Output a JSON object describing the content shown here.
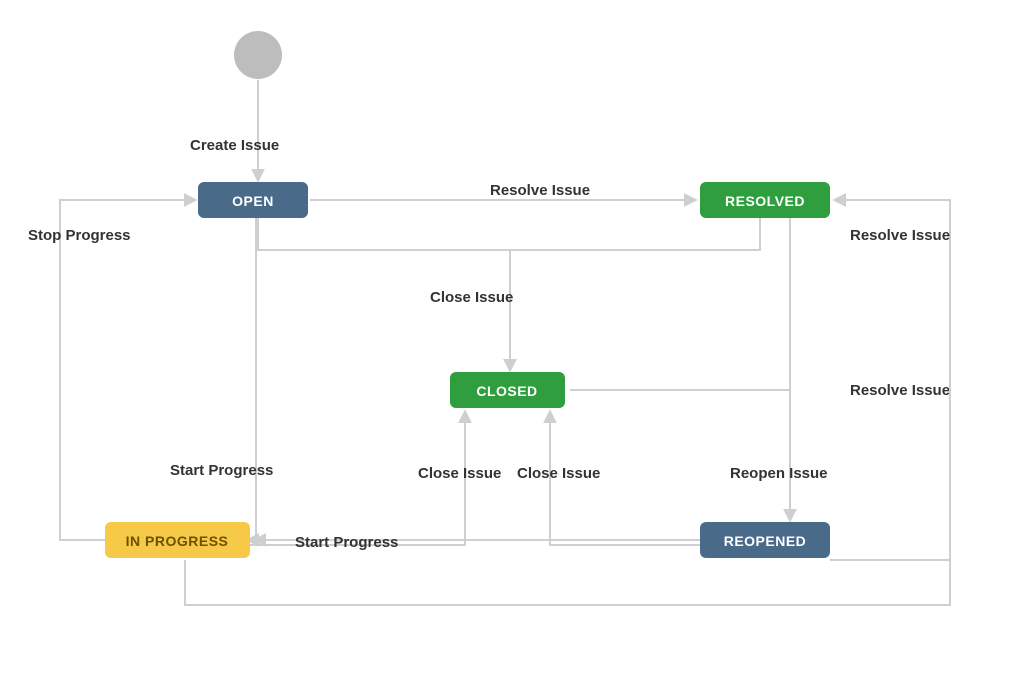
{
  "colors": {
    "blue": "#4a6a8a",
    "green": "#2e9e3f",
    "yellow": "#f7c948",
    "grey_node": "#bdbdbd",
    "edge": "#cfcfcf",
    "text_dark": "#333333",
    "text_light": "#ffffff",
    "text_yellow": "#6a5200"
  },
  "nodes": {
    "start": {
      "label": "",
      "shape": "circle"
    },
    "open": {
      "label": "OPEN"
    },
    "resolved": {
      "label": "RESOLVED"
    },
    "closed": {
      "label": "CLOSED"
    },
    "in_progress": {
      "label": "IN PROGRESS"
    },
    "reopened": {
      "label": "REOPENED"
    }
  },
  "edges": {
    "create_issue": {
      "from": "start",
      "to": "open",
      "label": "Create Issue"
    },
    "open_to_resolved": {
      "from": "open",
      "to": "resolved",
      "label": "Resolve Issue"
    },
    "open_close": {
      "from": "open",
      "to": "closed",
      "label": "Close Issue"
    },
    "resolved_close": {
      "from": "resolved",
      "to": "closed",
      "label": "Close Issue"
    },
    "open_start_progress": {
      "from": "open",
      "to": "in_progress",
      "label": "Start Progress"
    },
    "inprogress_stop": {
      "from": "in_progress",
      "to": "open",
      "label": "Stop Progress"
    },
    "inprogress_close": {
      "from": "in_progress",
      "to": "closed",
      "label": "Close Issue"
    },
    "inprogress_resolve": {
      "from": "in_progress",
      "to": "resolved",
      "label": "Resolve Issue"
    },
    "resolved_reopen": {
      "from": "resolved",
      "to": "reopened",
      "label": "Reopen Issue"
    },
    "reopened_start_progress": {
      "from": "reopened",
      "to": "in_progress",
      "label": "Start Progress"
    },
    "reopened_resolve": {
      "from": "reopened",
      "to": "resolved",
      "label": "Resolve Issue"
    },
    "reopened_close": {
      "from": "reopened",
      "to": "closed",
      "label": "Close Issue"
    }
  }
}
